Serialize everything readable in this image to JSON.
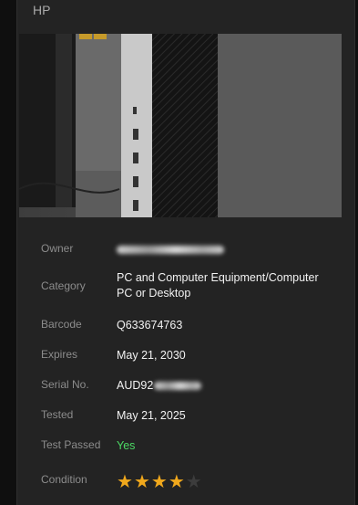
{
  "header": {
    "brand": "HP"
  },
  "details": {
    "owner": {
      "label": "Owner",
      "value": ""
    },
    "category": {
      "label": "Category",
      "value": "PC and Computer Equipment/Computer PC or Desktop"
    },
    "barcode": {
      "label": "Barcode",
      "value": "Q633674763"
    },
    "expires": {
      "label": "Expires",
      "value": "May 21, 2030"
    },
    "serial": {
      "label": "Serial No.",
      "value_prefix": "AUD92"
    },
    "tested": {
      "label": "Tested",
      "value": "May 21, 2025"
    },
    "test_passed": {
      "label": "Test Passed",
      "value": "Yes"
    },
    "condition": {
      "label": "Condition",
      "rating": 4,
      "max_rating": 5
    }
  },
  "colors": {
    "star_on": "#f0a81c",
    "star_off": "#3c3c3c",
    "pass": "#4cd964"
  }
}
